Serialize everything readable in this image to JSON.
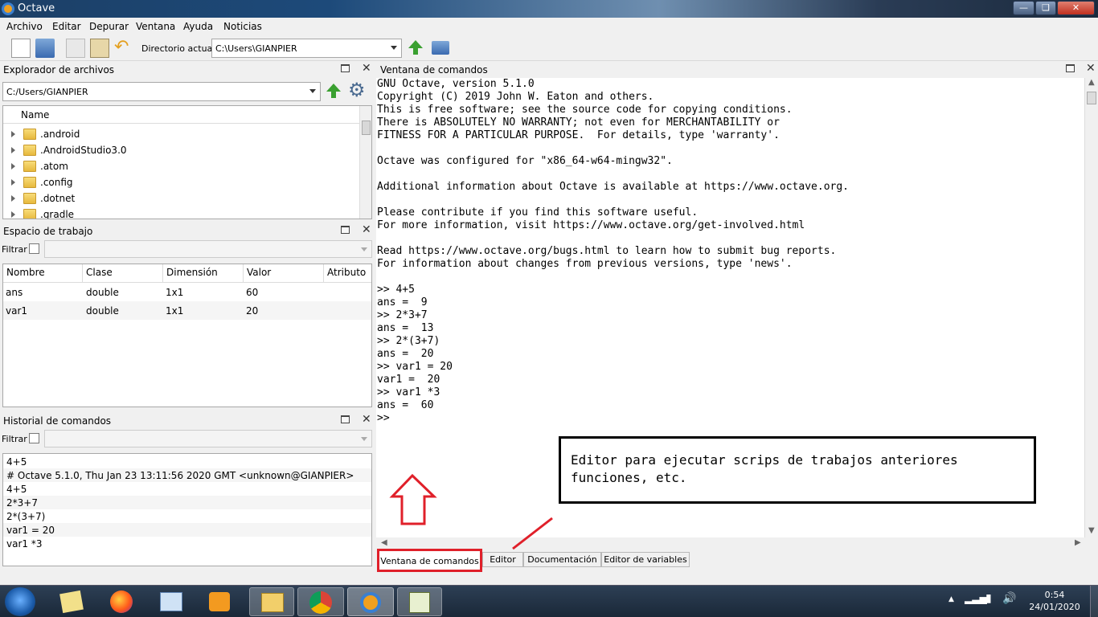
{
  "window": {
    "title": "Octave"
  },
  "menu": [
    "Archivo",
    "Editar",
    "Depurar",
    "Ventana",
    "Ayuda",
    "Noticias"
  ],
  "toolbar": {
    "dir_label": "Directorio actual:",
    "dir_value": "C:\\Users\\GIANPIER"
  },
  "file_browser": {
    "title": "Explorador de archivos",
    "path": "C:/Users/GIANPIER",
    "column": "Name",
    "items": [
      ".android",
      ".AndroidStudio3.0",
      ".atom",
      ".config",
      ".dotnet",
      ".gradle"
    ]
  },
  "workspace": {
    "title": "Espacio de trabajo",
    "filter_label": "Filtrar",
    "columns": [
      "Nombre",
      "Clase",
      "Dimensión",
      "Valor",
      "Atributo"
    ],
    "rows": [
      {
        "nombre": "ans",
        "clase": "double",
        "dim": "1x1",
        "valor": "60",
        "attr": ""
      },
      {
        "nombre": "var1",
        "clase": "double",
        "dim": "1x1",
        "valor": "20",
        "attr": ""
      }
    ]
  },
  "history": {
    "title": "Historial de comandos",
    "filter_label": "Filtrar",
    "items": [
      "4+5",
      "# Octave 5.1.0, Thu Jan 23 13:11:56 2020 GMT <unknown@GIANPIER>",
      "4+5",
      "2*3+7",
      "2*(3+7)",
      "var1 = 20",
      "var1 *3"
    ]
  },
  "command_window": {
    "title": "Ventana de comandos",
    "lines": [
      "GNU Octave, version 5.1.0",
      "Copyright (C) 2019 John W. Eaton and others.",
      "This is free software; see the source code for copying conditions.",
      "There is ABSOLUTELY NO WARRANTY; not even for MERCHANTABILITY or",
      "FITNESS FOR A PARTICULAR PURPOSE.  For details, type 'warranty'.",
      "",
      "Octave was configured for \"x86_64-w64-mingw32\".",
      "",
      "Additional information about Octave is available at https://www.octave.org.",
      "",
      "Please contribute if you find this software useful.",
      "For more information, visit https://www.octave.org/get-involved.html",
      "",
      "Read https://www.octave.org/bugs.html to learn how to submit bug reports.",
      "For information about changes from previous versions, type 'news'.",
      "",
      ">> 4+5",
      "ans =  9",
      ">> 2*3+7",
      "ans =  13",
      ">> 2*(3+7)",
      "ans =  20",
      ">> var1 = 20",
      "var1 =  20",
      ">> var1 *3",
      "ans =  60",
      ">>"
    ]
  },
  "annotation": {
    "text_line1": "Editor para ejecutar scrips de trabajos anteriores",
    "text_line2": "funciones, etc.",
    "color": "#e0202a"
  },
  "tabs": [
    "Ventana de comandos",
    "Editor",
    "Documentación",
    "Editor de variables"
  ],
  "clock": {
    "time": "0:54",
    "date": "24/01/2020"
  }
}
